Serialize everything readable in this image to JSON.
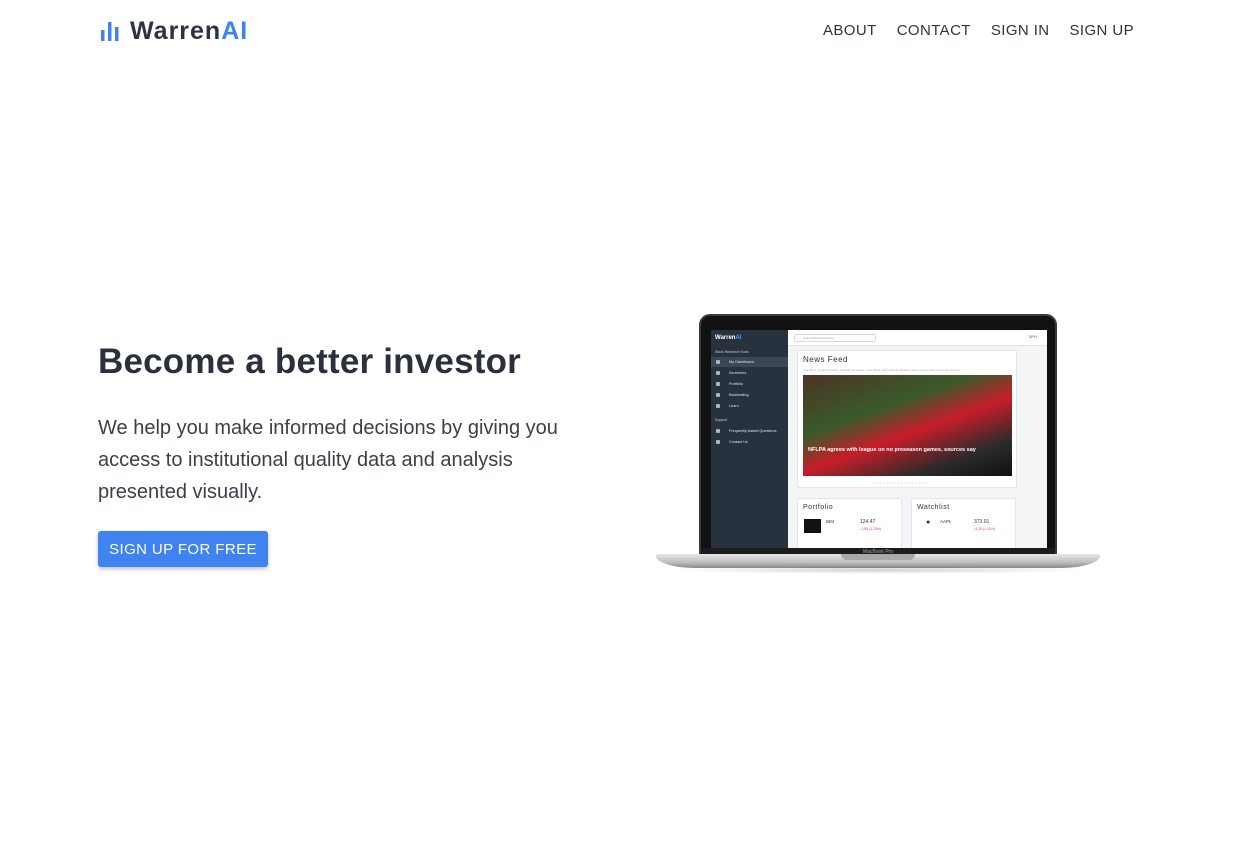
{
  "header": {
    "brand_main": "Warren",
    "brand_accent": "AI",
    "nav": [
      "ABOUT",
      "CONTACT",
      "SIGN IN",
      "SIGN UP"
    ]
  },
  "hero": {
    "title": "Become a better investor",
    "subtitle": "We help you make informed decisions by giving you access to institutional quality data and analysis presented visually.",
    "cta_label": "SIGN UP FOR FREE"
  },
  "laptop": {
    "model_label": "MacBook Pro",
    "app": {
      "brand_main": "Warren",
      "brand_accent": "AI",
      "section_tools": "Stock Research Tools",
      "tools": [
        "My Dashboard",
        "Screeners",
        "Portfolio",
        "Backtesting",
        "Learn"
      ],
      "section_support": "Support",
      "support": [
        "Frequently Asked Questions",
        "Contact Us"
      ],
      "search_placeholder": "Search Stocks & Coins",
      "user_menu": "SPH",
      "news_title": "News Feed",
      "news_meta": "The latest, comprehensive, institutional quality news alerts and business updates about events from across all sectors.",
      "news_headline": "NFLPA agrees with league on no preseason games, sources say",
      "portfolio_title": "Portfolio",
      "portfolio_ticker": "IBM",
      "portfolio_price": "124.47",
      "portfolio_change": "-1.55 (1.23%)",
      "watchlist_title": "Watchlist",
      "watchlist_ticker": "AAPL",
      "watchlist_price": "373.01",
      "watchlist_change": "-4.20 (1.11%)"
    }
  },
  "colors": {
    "accent": "#3f83f0",
    "text": "#2d3440",
    "sidebar": "#28323f"
  }
}
